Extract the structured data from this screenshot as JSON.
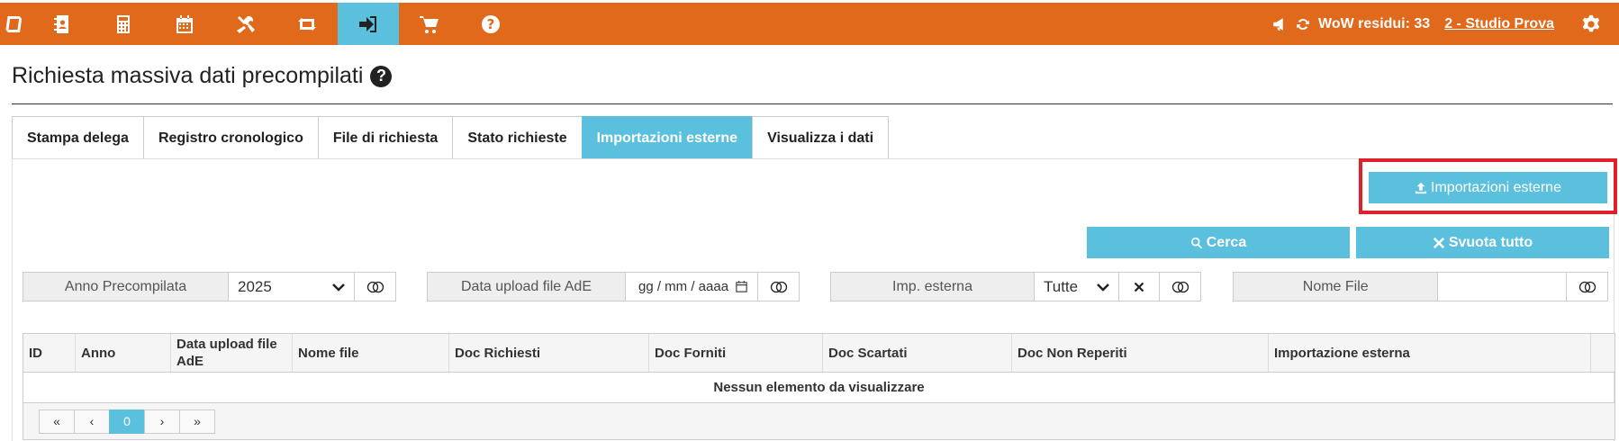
{
  "topbar": {
    "nav": [
      {
        "icon": "book-icon",
        "name": "nav-book"
      },
      {
        "icon": "contacts-icon",
        "name": "nav-contacts"
      },
      {
        "icon": "calculator-icon",
        "name": "nav-calculator"
      },
      {
        "icon": "calendar-icon",
        "name": "nav-calendar"
      },
      {
        "icon": "tools-icon",
        "name": "nav-tools"
      },
      {
        "icon": "retweet-icon",
        "name": "nav-sync"
      },
      {
        "icon": "sign-in-icon",
        "name": "nav-import",
        "active": true
      },
      {
        "icon": "cart-icon",
        "name": "nav-cart"
      },
      {
        "icon": "question-icon",
        "name": "nav-help"
      }
    ],
    "wow_label": "WoW residui: 33",
    "studio": "2 - Studio Prova",
    "accent": "#e0691c",
    "active_color": "#5bc0de"
  },
  "page": {
    "title": "Richiesta massiva dati precompilati",
    "help_glyph": "?"
  },
  "tabs": [
    {
      "label": "Stampa delega",
      "active": false
    },
    {
      "label": "Registro cronologico",
      "active": false
    },
    {
      "label": "File di richiesta",
      "active": false
    },
    {
      "label": "Stato richieste",
      "active": false
    },
    {
      "label": "Importazioni esterne",
      "active": true
    },
    {
      "label": "Visualizza i dati",
      "active": false
    }
  ],
  "buttons": {
    "import": "Importazioni esterne",
    "cerca": "Cerca",
    "svuota": "Svuota tutto"
  },
  "filters": {
    "anno": {
      "label": "Anno Precompilata",
      "value": "2025"
    },
    "data_upload": {
      "label": "Data upload file AdE",
      "placeholder": "gg / mm / aaaa"
    },
    "imp_esterna": {
      "label": "Imp. esterna",
      "value": "Tutte"
    },
    "nome_file": {
      "label": "Nome File",
      "value": ""
    }
  },
  "table": {
    "columns": [
      "ID",
      "Anno",
      "Data upload file AdE",
      "Nome file",
      "Doc Richiesti",
      "Doc Forniti",
      "Doc Scartati",
      "Doc Non Reperiti",
      "Importazione esterna"
    ],
    "empty_text": "Nessun elemento da visualizzare"
  },
  "pager": {
    "first": "«",
    "prev": "‹",
    "current": "0",
    "next": "›",
    "last": "»"
  }
}
